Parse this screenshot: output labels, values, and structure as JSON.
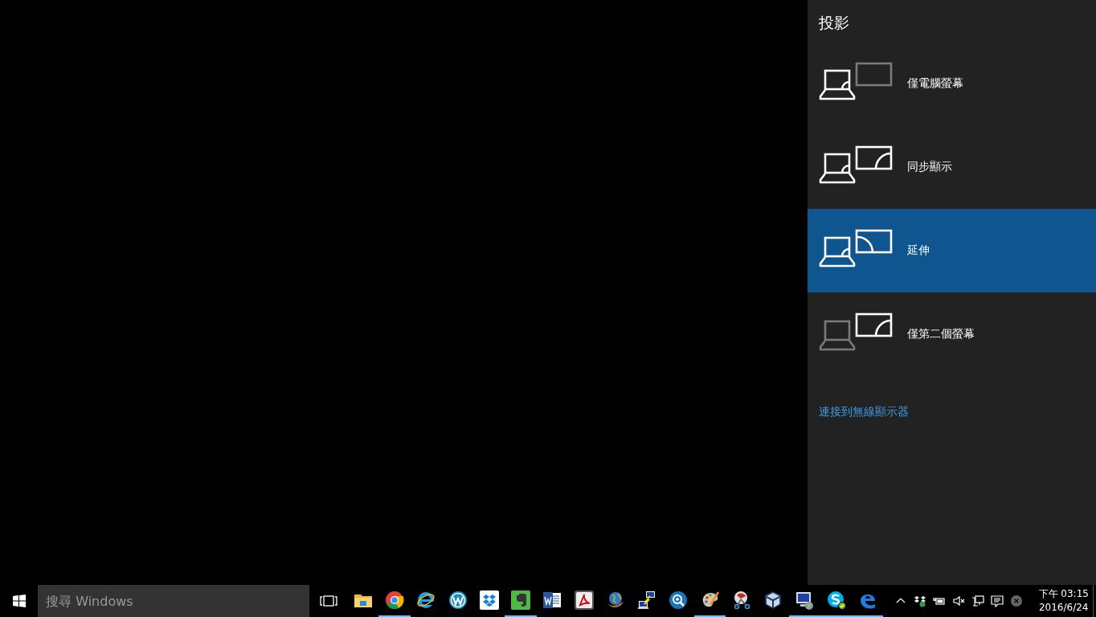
{
  "panel": {
    "title": "投影",
    "options": [
      {
        "kind": "pc_only",
        "label": "僅電腦螢幕",
        "selected": false
      },
      {
        "kind": "duplicate",
        "label": "同步顯示",
        "selected": false
      },
      {
        "kind": "extend",
        "label": "延伸",
        "selected": true
      },
      {
        "kind": "second_only",
        "label": "僅第二個螢幕",
        "selected": false
      }
    ],
    "link": "連接到無線顯示器"
  },
  "taskbar": {
    "search": {
      "placeholder": "搜尋 Windows"
    },
    "apps": [
      {
        "kind": "folder",
        "running": false
      },
      {
        "kind": "chrome",
        "running": true
      },
      {
        "kind": "ie",
        "running": false
      },
      {
        "kind": "wordpress",
        "running": false
      },
      {
        "kind": "dropbox",
        "running": false
      },
      {
        "kind": "evernote",
        "running": true
      },
      {
        "kind": "word",
        "running": false
      },
      {
        "kind": "pdf",
        "running": false
      },
      {
        "kind": "globe",
        "running": false
      },
      {
        "kind": "network",
        "running": false
      },
      {
        "kind": "magnifier",
        "running": false
      },
      {
        "kind": "paint",
        "running": true
      },
      {
        "kind": "scissors",
        "running": false
      },
      {
        "kind": "cube",
        "running": false
      },
      {
        "kind": "remote",
        "running": true
      },
      {
        "kind": "skype",
        "running": true
      },
      {
        "kind": "edge",
        "running": true
      }
    ],
    "clock": {
      "time": "下午 03:15",
      "date": "2016/6/24"
    }
  }
}
